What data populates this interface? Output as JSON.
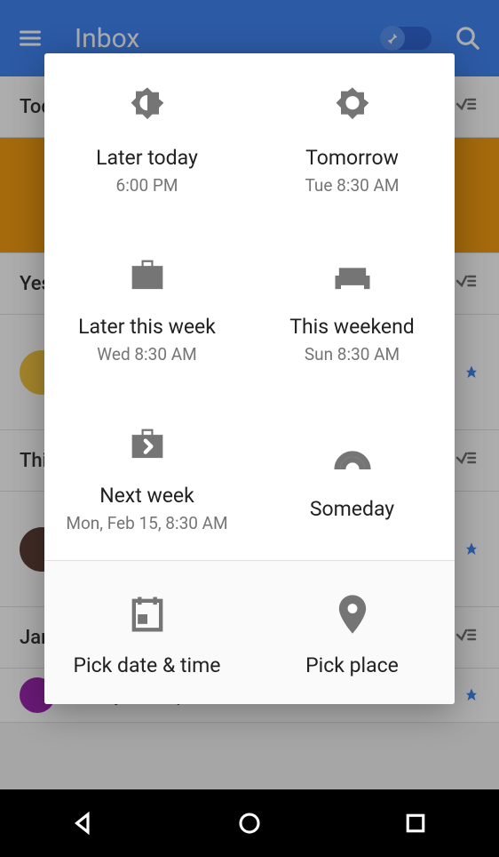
{
  "header": {
    "title": "Inbox"
  },
  "sections": {
    "today": "Today",
    "yesterday": "Yesterday",
    "thismonth": "This month",
    "january": "January"
  },
  "snooze": {
    "later_today": {
      "title": "Later today",
      "sub": "6:00 PM"
    },
    "tomorrow": {
      "title": "Tomorrow",
      "sub": "Tue 8:30 AM"
    },
    "later_week": {
      "title": "Later this week",
      "sub": "Wed 8:30 AM"
    },
    "weekend": {
      "title": "This weekend",
      "sub": "Sun 8:30 AM"
    },
    "next_week": {
      "title": "Next week",
      "sub": "Mon, Feb 15, 8:30 AM"
    },
    "someday": {
      "title": "Someday"
    },
    "pick_date": {
      "title": "Pick date & time"
    },
    "pick_place": {
      "title": "Pick place"
    }
  },
  "preview_text": "need your help"
}
